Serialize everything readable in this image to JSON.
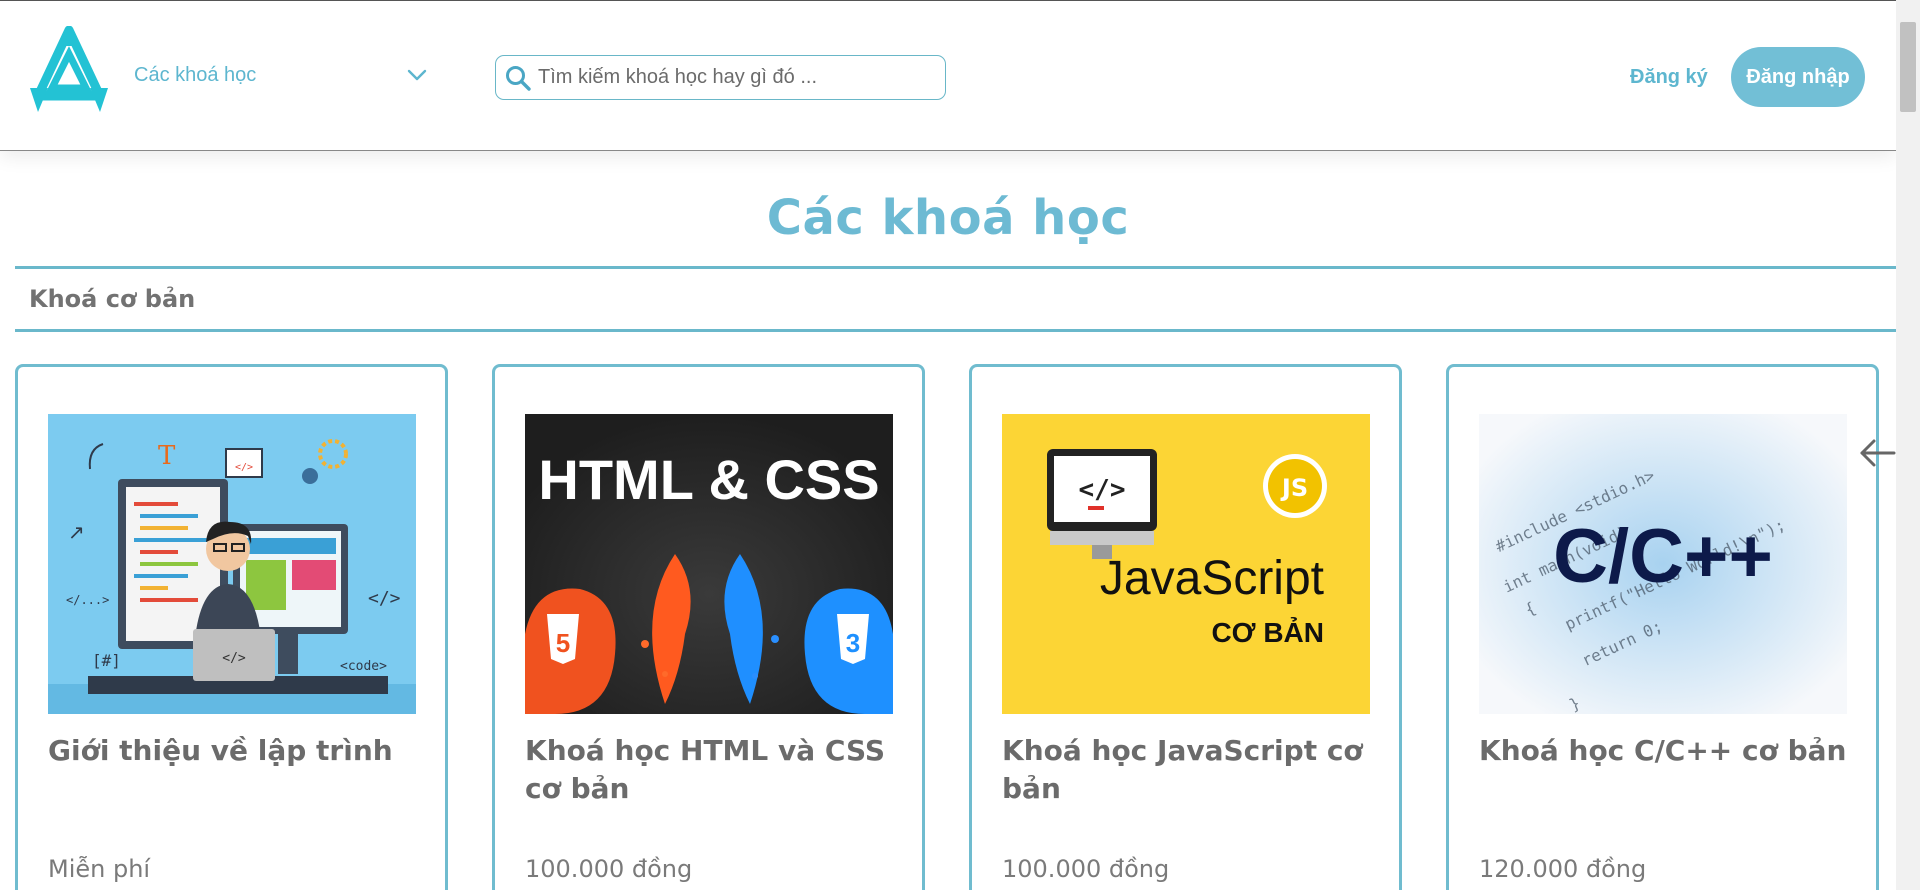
{
  "header": {
    "logo_icon": "a-triangle-logo",
    "category_label": "Các khoá học",
    "search_placeholder": "Tìm kiếm khoá học hay gì đó ...",
    "register_label": "Đăng ký",
    "login_label": "Đăng nhập"
  },
  "main": {
    "page_title": "Các khoá học",
    "section_label": "Khoá cơ bản",
    "courses": [
      {
        "title": "Giới thiệu về lập trình",
        "price": "Miễn phí"
      },
      {
        "title": "Khoá học HTML và CSS cơ bản",
        "price": "100.000 đồng",
        "image_text": "HTML & CSS"
      },
      {
        "title": "Khoá học JavaScript cơ bản",
        "price": "100.000 đồng",
        "image_text": [
          "JavaScript",
          "CƠ BẢN",
          "</>",
          "JS"
        ]
      },
      {
        "title": "Khoá học C/C++ cơ bản",
        "price": "120.000 đồng",
        "image_text": [
          "C/C++",
          "#include <stdio.h>",
          "int main(void)",
          "{",
          "printf(\"Hello World!\\n\");",
          "return 0;",
          "}"
        ]
      }
    ],
    "carousel_icon": "arrow-left-icon"
  },
  "colors": {
    "accent": "#6dbad3",
    "login_button": "#72bfd6",
    "text_gray": "#6b6b6b",
    "js_yellow": "#fcd535",
    "html_dark": "#2a2a2a"
  }
}
